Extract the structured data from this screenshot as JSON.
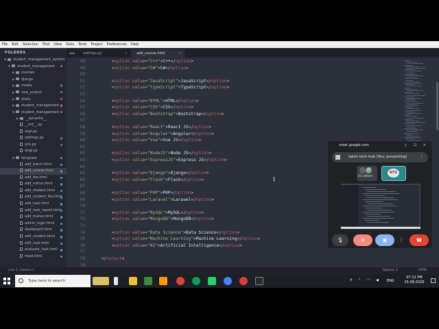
{
  "menu": [
    "File",
    "Edit",
    "Selection",
    "Find",
    "View",
    "Goto",
    "Tools",
    "Project",
    "Preferences",
    "Help"
  ],
  "sidebar": {
    "header": "FOLDERS",
    "items": [
      {
        "label": "student_management_system",
        "type": "folder",
        "depth": 0,
        "open": true,
        "dot": ""
      },
      {
        "label": "student_management",
        "type": "folder",
        "depth": 1,
        "open": true,
        "dot": "red"
      },
      {
        "label": "courses",
        "type": "folder",
        "depth": 2,
        "open": false,
        "dot": ""
      },
      {
        "label": "django",
        "type": "folder",
        "depth": 2,
        "open": false,
        "dot": ""
      },
      {
        "label": "media",
        "type": "folder",
        "depth": 2,
        "open": false,
        "dot": "ring"
      },
      {
        "label": "new_project",
        "type": "folder",
        "depth": 2,
        "open": false,
        "dot": "ring"
      },
      {
        "label": "static",
        "type": "folder",
        "depth": 2,
        "open": false,
        "dot": "ring"
      },
      {
        "label": "student_management",
        "type": "folder",
        "depth": 2,
        "open": false,
        "dot": "red"
      },
      {
        "label": "student_management",
        "type": "folder",
        "depth": 2,
        "open": true,
        "dot": "ring"
      },
      {
        "label": "__pycache__",
        "type": "folder",
        "depth": 3,
        "open": false,
        "dot": ""
      },
      {
        "label": "__init__.py",
        "type": "file",
        "depth": 3,
        "dot": ""
      },
      {
        "label": "asgi.py",
        "type": "file",
        "depth": 3,
        "dot": ""
      },
      {
        "label": "settings.py",
        "type": "file",
        "depth": 3,
        "dot": "ring"
      },
      {
        "label": "urls.py",
        "type": "file",
        "depth": 3,
        "dot": "ring"
      },
      {
        "label": "wsgi.py",
        "type": "file",
        "depth": 3,
        "dot": ""
      },
      {
        "label": "template",
        "type": "folder",
        "depth": 2,
        "open": true,
        "dot": "blue"
      },
      {
        "label": "add_batch.html",
        "type": "file",
        "depth": 3,
        "dot": "blue"
      },
      {
        "label": "add_course.html",
        "type": "file",
        "depth": 3,
        "dot": "blue",
        "selected": true
      },
      {
        "label": "add_fee.html",
        "type": "file",
        "depth": 3,
        "dot": "blue"
      },
      {
        "label": "add_notice.html",
        "type": "file",
        "depth": 3,
        "dot": "blue"
      },
      {
        "label": "add_student.html",
        "type": "file",
        "depth": 3,
        "dot": "blue"
      },
      {
        "label": "add_student_fee.html",
        "type": "file",
        "depth": 3,
        "dot": "blue"
      },
      {
        "label": "add_task.html",
        "type": "file",
        "depth": 3,
        "dot": "blue"
      },
      {
        "label": "add_task_report.html",
        "type": "file",
        "depth": 3,
        "dot": "blue"
      },
      {
        "label": "add_trainer.html",
        "type": "file",
        "depth": 3,
        "dot": "blue"
      },
      {
        "label": "admin_login.html",
        "type": "file",
        "depth": 3,
        "dot": "blue"
      },
      {
        "label": "dashboard.html",
        "type": "file",
        "depth": 3,
        "dot": "blue"
      },
      {
        "label": "edit_student.html",
        "type": "file",
        "depth": 3,
        "dot": "blue"
      },
      {
        "label": "edit_task.html",
        "type": "file",
        "depth": 3,
        "dot": "blue"
      },
      {
        "label": "evaluate_task.html",
        "type": "file",
        "depth": 3,
        "dot": "blue"
      },
      {
        "label": "head.html",
        "type": "file",
        "depth": 3,
        "dot": "blue"
      }
    ]
  },
  "tabs": [
    {
      "label": "settings.py",
      "active": false
    },
    {
      "label": "add_course.html",
      "active": true
    }
  ],
  "editor": {
    "lines": [
      {
        "n": "48",
        "indent": "        ",
        "value": "C++",
        "text": "C++"
      },
      {
        "n": "49",
        "indent": "        ",
        "value": "C#",
        "text": "C#"
      },
      {
        "n": "50",
        "indent": "",
        "value": "",
        "text": ""
      },
      {
        "n": "51",
        "indent": "        ",
        "value": "JavaScript",
        "text": "JavaScript"
      },
      {
        "n": "52",
        "indent": "        ",
        "value": "TypeScript",
        "text": "TypeScript"
      },
      {
        "n": "53",
        "indent": "",
        "value": "",
        "text": ""
      },
      {
        "n": "54",
        "indent": "        ",
        "value": "HTML",
        "text": "HTML"
      },
      {
        "n": "55",
        "indent": "        ",
        "value": "CSS",
        "text": "CSS"
      },
      {
        "n": "56",
        "indent": "        ",
        "value": "Bootstrap",
        "text": "Bootstrap"
      },
      {
        "n": "57",
        "indent": "",
        "value": "",
        "text": ""
      },
      {
        "n": "58",
        "indent": "        ",
        "value": "React",
        "text": "React JS"
      },
      {
        "n": "59",
        "indent": "        ",
        "value": "Angular",
        "text": "Angular"
      },
      {
        "n": "60",
        "indent": "        ",
        "value": "Vue",
        "text": "Vue JS"
      },
      {
        "n": "61",
        "indent": "",
        "value": "",
        "text": ""
      },
      {
        "n": "62",
        "indent": "        ",
        "value": "NodeJS",
        "text": "Node JS"
      },
      {
        "n": "63",
        "indent": "        ",
        "value": "ExpressJS",
        "text": "Express JS"
      },
      {
        "n": "64",
        "indent": "",
        "value": "",
        "text": ""
      },
      {
        "n": "65",
        "indent": "        ",
        "value": "Django",
        "text": "Django"
      },
      {
        "n": "66",
        "indent": "        ",
        "value": "Flask",
        "text": "Flask"
      },
      {
        "n": "67",
        "indent": "",
        "value": "",
        "text": ""
      },
      {
        "n": "68",
        "indent": "        ",
        "value": "PHP",
        "text": "PHP"
      },
      {
        "n": "69",
        "indent": "        ",
        "value": "Laravel",
        "text": "Laravel"
      },
      {
        "n": "70",
        "indent": "",
        "value": "",
        "text": ""
      },
      {
        "n": "71",
        "indent": "        ",
        "value": "MySQL",
        "text": "MySQL"
      },
      {
        "n": "72",
        "indent": "        ",
        "value": "MongoDB",
        "text": "MongoDB"
      },
      {
        "n": "73",
        "indent": "",
        "value": "",
        "text": ""
      },
      {
        "n": "74",
        "indent": "        ",
        "value": "Data Science",
        "text": "Data Science"
      },
      {
        "n": "75",
        "indent": "        ",
        "value": "Machine Learning",
        "text": "Machine Learning"
      },
      {
        "n": "76",
        "indent": "        ",
        "value": "AI",
        "text": "Artificial Intelligence"
      },
      {
        "n": "77",
        "indent": "",
        "value": "",
        "text": ""
      },
      {
        "n": "78",
        "indent": "    ",
        "close": "select"
      },
      {
        "n": "79",
        "indent": "",
        "value": "",
        "text": ""
      }
    ]
  },
  "status": {
    "left": "Line 1, Column 1",
    "spaces": "Spaces: 2",
    "syntax": "HTML"
  },
  "meet": {
    "url": "meet.google.com",
    "presenting": "laksh tech hub (You, presenting)",
    "others": "21 others",
    "avatar_letter": "P",
    "colors": {
      "end_call": "#ea4335",
      "camera_off": "#f28b82",
      "present": "#8ab4f8"
    }
  },
  "taskbar": {
    "search_placeholder": "Type here to search",
    "lang": "ENG",
    "time": "07:12 PM",
    "date": "25-08-2026"
  }
}
